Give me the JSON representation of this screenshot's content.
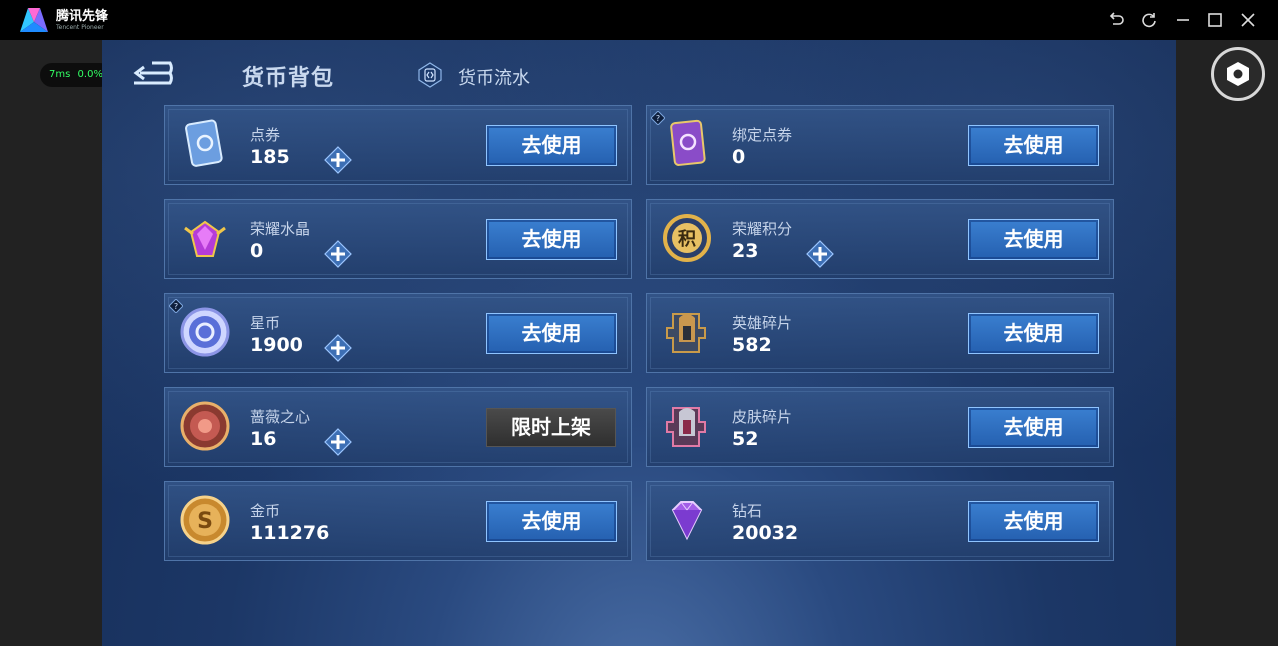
{
  "titlebar": {
    "app_name": "腾讯先锋",
    "app_sub": "Tencent Pioneer",
    "buttons": [
      "back-icon",
      "refresh-icon",
      "minimize-icon",
      "maximize-icon",
      "close-icon"
    ]
  },
  "overlay": {
    "latency": "7ms",
    "loss": "0.0%",
    "float_button": "hexagon-icon"
  },
  "header": {
    "title": "货币背包",
    "history_label": "货币流水"
  },
  "colors": {
    "accent_blue": "#3a7fd0",
    "card_border": "#4f74a8",
    "value_text": "#ffffff",
    "label_text": "#c6d4ea",
    "limited_btn": "#3a3a3a"
  },
  "currencies": [
    {
      "name": "点券",
      "value": "185",
      "button": "去使用",
      "has_plus": true,
      "has_question": false,
      "icon": "voucher-icon"
    },
    {
      "name": "绑定点券",
      "value": "0",
      "button": "去使用",
      "has_plus": false,
      "has_question": true,
      "icon": "bound-voucher-icon"
    },
    {
      "name": "荣耀水晶",
      "value": "0",
      "button": "去使用",
      "has_plus": true,
      "has_question": false,
      "icon": "glory-crystal-icon"
    },
    {
      "name": "荣耀积分",
      "value": "23",
      "button": "去使用",
      "has_plus": true,
      "has_question": false,
      "icon": "glory-points-icon"
    },
    {
      "name": "星币",
      "value": "1900",
      "button": "去使用",
      "has_plus": true,
      "has_question": true,
      "icon": "star-coin-icon"
    },
    {
      "name": "英雄碎片",
      "value": "582",
      "button": "去使用",
      "has_plus": false,
      "has_question": false,
      "icon": "hero-shard-icon"
    },
    {
      "name": "蔷薇之心",
      "value": "16",
      "button": "限时上架",
      "has_plus": true,
      "has_question": false,
      "icon": "rose-heart-icon"
    },
    {
      "name": "皮肤碎片",
      "value": "52",
      "button": "去使用",
      "has_plus": false,
      "has_question": false,
      "icon": "skin-shard-icon"
    },
    {
      "name": "金币",
      "value": "111276",
      "button": "去使用",
      "has_plus": false,
      "has_question": false,
      "icon": "gold-coin-icon"
    },
    {
      "name": "钻石",
      "value": "20032",
      "button": "去使用",
      "has_plus": false,
      "has_question": false,
      "icon": "diamond-icon"
    }
  ]
}
